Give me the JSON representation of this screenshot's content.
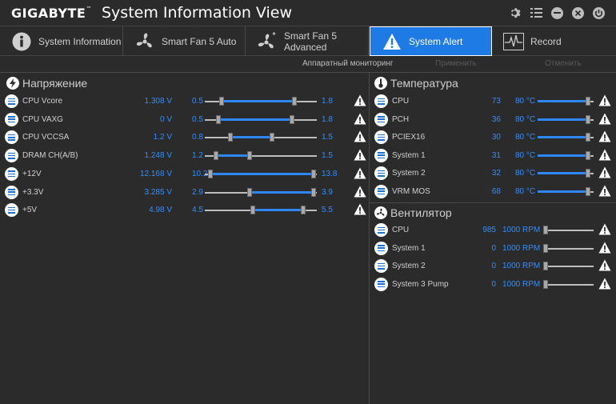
{
  "brand": "GIGABYTE",
  "brand_sup": "™",
  "app_title": "System Information View",
  "colors": {
    "accent": "#1e7be5",
    "value_blue": "#2f8fff",
    "background": "#2b2b2b"
  },
  "window_controls": [
    "gear-icon",
    "list-icon",
    "minimize-icon",
    "close-icon",
    "exit-icon"
  ],
  "tabs": [
    {
      "label": "System Information",
      "icon": "info-icon",
      "active": false
    },
    {
      "label": "Smart Fan 5 Auto",
      "icon": "fan-icon",
      "active": false
    },
    {
      "label": "Smart Fan 5 Advanced",
      "icon": "fan-advanced-icon",
      "active": false
    },
    {
      "label": "System Alert",
      "icon": "warning-icon",
      "active": true
    },
    {
      "label": "Record",
      "icon": "waveform-icon",
      "active": false
    }
  ],
  "subbar": {
    "monitoring": "Аппаратный мониторинг",
    "apply": "Применить",
    "cancel": "Отменить"
  },
  "voltage": {
    "title": "Напряжение",
    "rows": [
      {
        "name": "CPU Vcore",
        "value": "1.308 V",
        "min": "0.5",
        "max": "1.8",
        "lo": 0.15,
        "hi": 0.8
      },
      {
        "name": "CPU VAXG",
        "value": "0 V",
        "min": "0.5",
        "max": "1.8",
        "lo": 0.12,
        "hi": 0.78
      },
      {
        "name": "CPU VCCSA",
        "value": "1.2 V",
        "min": "0.8",
        "max": "1.5",
        "lo": 0.23,
        "hi": 0.6
      },
      {
        "name": "DRAM CH(A/B)",
        "value": "1.248 V",
        "min": "1.2",
        "max": "1.5",
        "lo": 0.1,
        "hi": 0.4
      },
      {
        "name": "+12V",
        "value": "12.168 V",
        "min": "10.2",
        "max": "13.8",
        "lo": 0.05,
        "hi": 0.97
      },
      {
        "name": "+3.3V",
        "value": "3.285 V",
        "min": "2.9",
        "max": "3.9",
        "lo": 0.4,
        "hi": 0.97
      },
      {
        "name": "+5V",
        "value": "4.98 V",
        "min": "4.5",
        "max": "5.5",
        "lo": 0.43,
        "hi": 0.88
      }
    ]
  },
  "temperature": {
    "title": "Температура",
    "rows": [
      {
        "name": "CPU",
        "value": "73",
        "limit": "80 °C",
        "level": 0.9
      },
      {
        "name": "PCH",
        "value": "36",
        "limit": "80 °C",
        "level": 0.9
      },
      {
        "name": "PCIEX16",
        "value": "30",
        "limit": "80 °C",
        "level": 0.9
      },
      {
        "name": "System 1",
        "value": "31",
        "limit": "80 °C",
        "level": 0.9
      },
      {
        "name": "System 2",
        "value": "32",
        "limit": "80 °C",
        "level": 0.9
      },
      {
        "name": "VRM MOS",
        "value": "68",
        "limit": "80 °C",
        "level": 0.9
      }
    ]
  },
  "fan": {
    "title": "Вентилятор",
    "rows": [
      {
        "name": "CPU",
        "value": "985",
        "limit": "1000 RPM",
        "level": 0.03
      },
      {
        "name": "System 1",
        "value": "0",
        "limit": "1000 RPM",
        "level": 0.03
      },
      {
        "name": "System 2",
        "value": "0",
        "limit": "1000 RPM",
        "level": 0.03
      },
      {
        "name": "System 3 Pump",
        "value": "0",
        "limit": "1000 RPM",
        "level": 0.03
      }
    ]
  }
}
